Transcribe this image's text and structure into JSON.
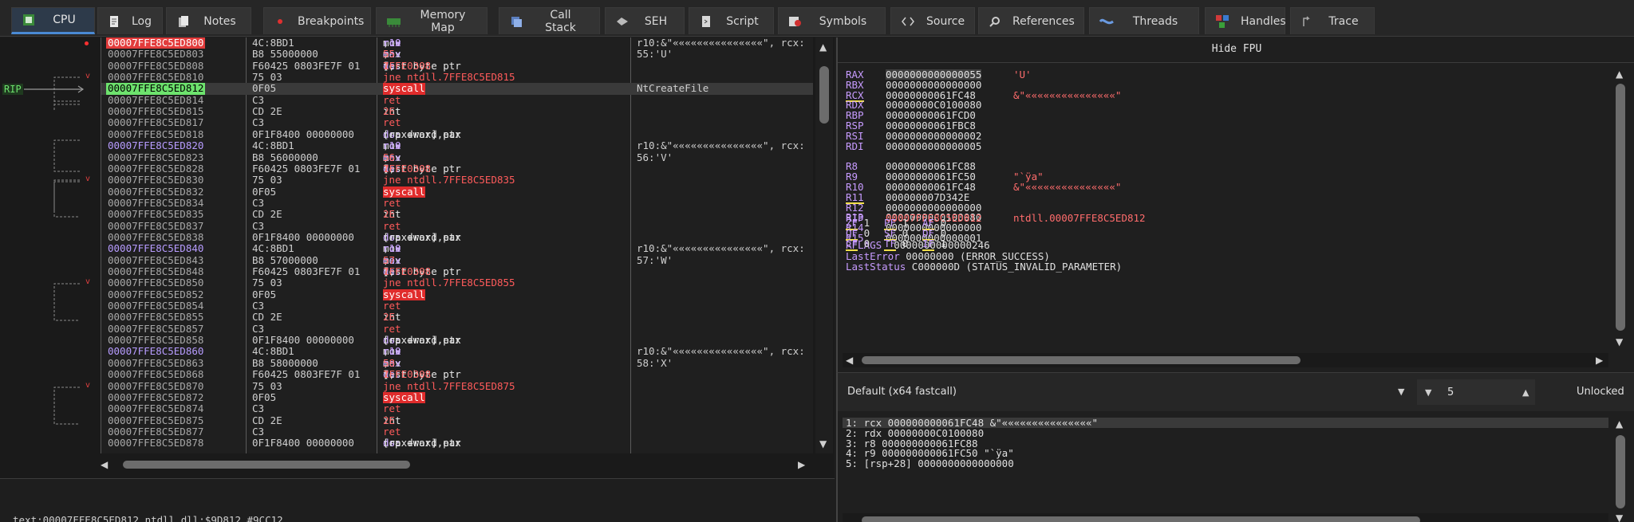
{
  "tabs": [
    {
      "label": "CPU",
      "icon": "cpu-icon",
      "active": true
    },
    {
      "label": "Log",
      "icon": "log-icon"
    },
    {
      "label": "Notes",
      "icon": "notes-icon"
    },
    {
      "label": "Breakpoints",
      "icon": "breakpoint-icon"
    },
    {
      "label": "Memory Map",
      "icon": "memory-map-icon"
    },
    {
      "label": "Call Stack",
      "icon": "call-stack-icon"
    },
    {
      "label": "SEH",
      "icon": "seh-icon"
    },
    {
      "label": "Script",
      "icon": "script-icon"
    },
    {
      "label": "Symbols",
      "icon": "symbols-icon"
    },
    {
      "label": "Source",
      "icon": "source-icon"
    },
    {
      "label": "References",
      "icon": "references-icon"
    },
    {
      "label": "Threads",
      "icon": "threads-icon"
    },
    {
      "label": "Handles",
      "icon": "handles-icon"
    },
    {
      "label": "Trace",
      "icon": "trace-icon"
    }
  ],
  "rip_label": "RIP",
  "disasm": [
    {
      "addr": "00007FFE8C5ED800",
      "bytes": "4C:8BD1",
      "instr": "mov r10,rcx",
      "comment": "r10:&\"«««««««««««««««\", rcx:",
      "bp": true
    },
    {
      "addr": "00007FFE8C5ED803",
      "bytes": "B8 55000000",
      "instr": "mov eax,55",
      "comment": "55:'U'"
    },
    {
      "addr": "00007FFE8C5ED808",
      "bytes": "F60425 0803FE7F 01",
      "instr": "test byte ptr ds:[7FFE0308],1",
      "comment": ""
    },
    {
      "addr": "00007FFE8C5ED810",
      "bytes": "75 03",
      "instr": "jne ntdll.7FFE8C5ED815",
      "comment": ""
    },
    {
      "addr": "00007FFE8C5ED812",
      "bytes": "0F05",
      "instr": "syscall",
      "comment": "NtCreateFile",
      "rip": true
    },
    {
      "addr": "00007FFE8C5ED814",
      "bytes": "C3",
      "instr": "ret",
      "comment": ""
    },
    {
      "addr": "00007FFE8C5ED815",
      "bytes": "CD 2E",
      "instr": "int 2E",
      "comment": ""
    },
    {
      "addr": "00007FFE8C5ED817",
      "bytes": "C3",
      "instr": "ret",
      "comment": ""
    },
    {
      "addr": "00007FFE8C5ED818",
      "bytes": "0F1F8400 00000000",
      "instr": "nop dword ptr ds:[rax+rax],eax",
      "comment": ""
    },
    {
      "addr": "00007FFE8C5ED820",
      "bytes": "4C:8BD1",
      "instr": "mov r10,rcx",
      "comment": "r10:&\"«««««««««««««««\", rcx:",
      "fn": true
    },
    {
      "addr": "00007FFE8C5ED823",
      "bytes": "B8 56000000",
      "instr": "mov eax,56",
      "comment": "56:'V'"
    },
    {
      "addr": "00007FFE8C5ED828",
      "bytes": "F60425 0803FE7F 01",
      "instr": "test byte ptr ds:[7FFE0308],1",
      "comment": ""
    },
    {
      "addr": "00007FFE8C5ED830",
      "bytes": "75 03",
      "instr": "jne ntdll.7FFE8C5ED835",
      "comment": ""
    },
    {
      "addr": "00007FFE8C5ED832",
      "bytes": "0F05",
      "instr": "syscall",
      "comment": ""
    },
    {
      "addr": "00007FFE8C5ED834",
      "bytes": "C3",
      "instr": "ret",
      "comment": ""
    },
    {
      "addr": "00007FFE8C5ED835",
      "bytes": "CD 2E",
      "instr": "int 2E",
      "comment": ""
    },
    {
      "addr": "00007FFE8C5ED837",
      "bytes": "C3",
      "instr": "ret",
      "comment": ""
    },
    {
      "addr": "00007FFE8C5ED838",
      "bytes": "0F1F8400 00000000",
      "instr": "nop dword ptr ds:[rax+rax],eax",
      "comment": ""
    },
    {
      "addr": "00007FFE8C5ED840",
      "bytes": "4C:8BD1",
      "instr": "mov r10,rcx",
      "comment": "r10:&\"«««««««««««««««\", rcx:",
      "fn": true
    },
    {
      "addr": "00007FFE8C5ED843",
      "bytes": "B8 57000000",
      "instr": "mov eax,57",
      "comment": "57:'W'"
    },
    {
      "addr": "00007FFE8C5ED848",
      "bytes": "F60425 0803FE7F 01",
      "instr": "test byte ptr ds:[7FFE0308],1",
      "comment": ""
    },
    {
      "addr": "00007FFE8C5ED850",
      "bytes": "75 03",
      "instr": "jne ntdll.7FFE8C5ED855",
      "comment": ""
    },
    {
      "addr": "00007FFE8C5ED852",
      "bytes": "0F05",
      "instr": "syscall",
      "comment": ""
    },
    {
      "addr": "00007FFE8C5ED854",
      "bytes": "C3",
      "instr": "ret",
      "comment": ""
    },
    {
      "addr": "00007FFE8C5ED855",
      "bytes": "CD 2E",
      "instr": "int 2E",
      "comment": ""
    },
    {
      "addr": "00007FFE8C5ED857",
      "bytes": "C3",
      "instr": "ret",
      "comment": ""
    },
    {
      "addr": "00007FFE8C5ED858",
      "bytes": "0F1F8400 00000000",
      "instr": "nop dword ptr ds:[rax+rax],eax",
      "comment": ""
    },
    {
      "addr": "00007FFE8C5ED860",
      "bytes": "4C:8BD1",
      "instr": "mov r10,rcx",
      "comment": "r10:&\"«««««««««««««««\", rcx:",
      "fn": true
    },
    {
      "addr": "00007FFE8C5ED863",
      "bytes": "B8 58000000",
      "instr": "mov eax,58",
      "comment": "58:'X'"
    },
    {
      "addr": "00007FFE8C5ED868",
      "bytes": "F60425 0803FE7F 01",
      "instr": "test byte ptr ds:[7FFE0308],1",
      "comment": ""
    },
    {
      "addr": "00007FFE8C5ED870",
      "bytes": "75 03",
      "instr": "jne ntdll.7FFE8C5ED875",
      "comment": ""
    },
    {
      "addr": "00007FFE8C5ED872",
      "bytes": "0F05",
      "instr": "syscall",
      "comment": ""
    },
    {
      "addr": "00007FFE8C5ED874",
      "bytes": "C3",
      "instr": "ret",
      "comment": ""
    },
    {
      "addr": "00007FFE8C5ED875",
      "bytes": "CD 2E",
      "instr": "int 2E",
      "comment": ""
    },
    {
      "addr": "00007FFE8C5ED877",
      "bytes": "C3",
      "instr": "ret",
      "comment": ""
    },
    {
      "addr": "00007FFE8C5ED878",
      "bytes": "0F1F8400 00000000",
      "instr": "nop dword ptr ds:[rax+rax],eax",
      "comment": ""
    }
  ],
  "status_line": "text:00007FFE8C5ED812 ntdll.dll:$9D812 #9CC12",
  "fpu_toggle": "Hide FPU",
  "registers": [
    {
      "name": "RAX",
      "value": "0000000000000055",
      "comment": "'U'",
      "hl": true
    },
    {
      "name": "RBX",
      "value": "0000000000000000",
      "comment": ""
    },
    {
      "name": "RCX",
      "value": "00000000061FC48",
      "comment": "&\"«««««««««««««««\"",
      "uline": true
    },
    {
      "name": "RDX",
      "value": "00000000C0100080",
      "comment": ""
    },
    {
      "name": "RBP",
      "value": "00000000061FCD0",
      "comment": ""
    },
    {
      "name": "RSP",
      "value": "00000000061FBC8",
      "comment": ""
    },
    {
      "name": "RSI",
      "value": "0000000000000002",
      "comment": ""
    },
    {
      "name": "RDI",
      "value": "0000000000000005",
      "comment": ""
    },
    {
      "name": "R8",
      "value": "00000000061FC88",
      "comment": ""
    },
    {
      "name": "R9",
      "value": "00000000061FC50",
      "comment": "\"`ÿa\""
    },
    {
      "name": "R10",
      "value": "00000000061FC48",
      "comment": "&\"«««««««««««««««\""
    },
    {
      "name": "R11",
      "value": "000000007D342E",
      "comment": "",
      "uline": true
    },
    {
      "name": "R12",
      "value": "0000000000000000",
      "comment": ""
    },
    {
      "name": "R13",
      "value": "00000000C0100080",
      "comment": ""
    },
    {
      "name": "R14",
      "value": "0000000000000000",
      "comment": ""
    },
    {
      "name": "R15",
      "value": "0000000000000001",
      "comment": ""
    }
  ],
  "rip_reg": {
    "name": "RIP",
    "value": "00007FFE8C5ED812",
    "comment": "ntdll.00007FFE8C5ED812"
  },
  "rflags": {
    "name": "RFLAGS",
    "value": "0000000000000246"
  },
  "flags": [
    {
      "name": "ZF",
      "value": "1"
    },
    {
      "name": "PF",
      "value": "1"
    },
    {
      "name": "AF",
      "value": "0"
    },
    {
      "name": "OF",
      "value": "0"
    },
    {
      "name": "SF",
      "value": "0"
    },
    {
      "name": "DF",
      "value": "0"
    },
    {
      "name": "CF",
      "value": "0"
    },
    {
      "name": "TF",
      "value": "0"
    },
    {
      "name": "IF",
      "value": "1"
    }
  ],
  "last_error": {
    "label": "LastError",
    "value": "00000000 (ERROR_SUCCESS)"
  },
  "last_status": {
    "label": "LastStatus",
    "value": "C000000D (STATUS_INVALID_PARAMETER)"
  },
  "callconv": {
    "label": "Default (x64 fastcall)",
    "count": "5",
    "lock": "Unlocked"
  },
  "args": [
    "1: rcx 000000000061FC48 &\"«««««««««««««««\"",
    "2: rdx 00000000C0100080",
    "3: r8 000000000061FC88",
    "4: r9 000000000061FC50 \"`ÿa\"",
    "5: [rsp+28] 0000000000000000"
  ],
  "colors": {
    "breakpoint": "#E23C3C",
    "rip": "#6DE26D",
    "register_name": "#C79BFF",
    "comment": "#FF6C6C",
    "tab_active": "#4A8AD4"
  }
}
